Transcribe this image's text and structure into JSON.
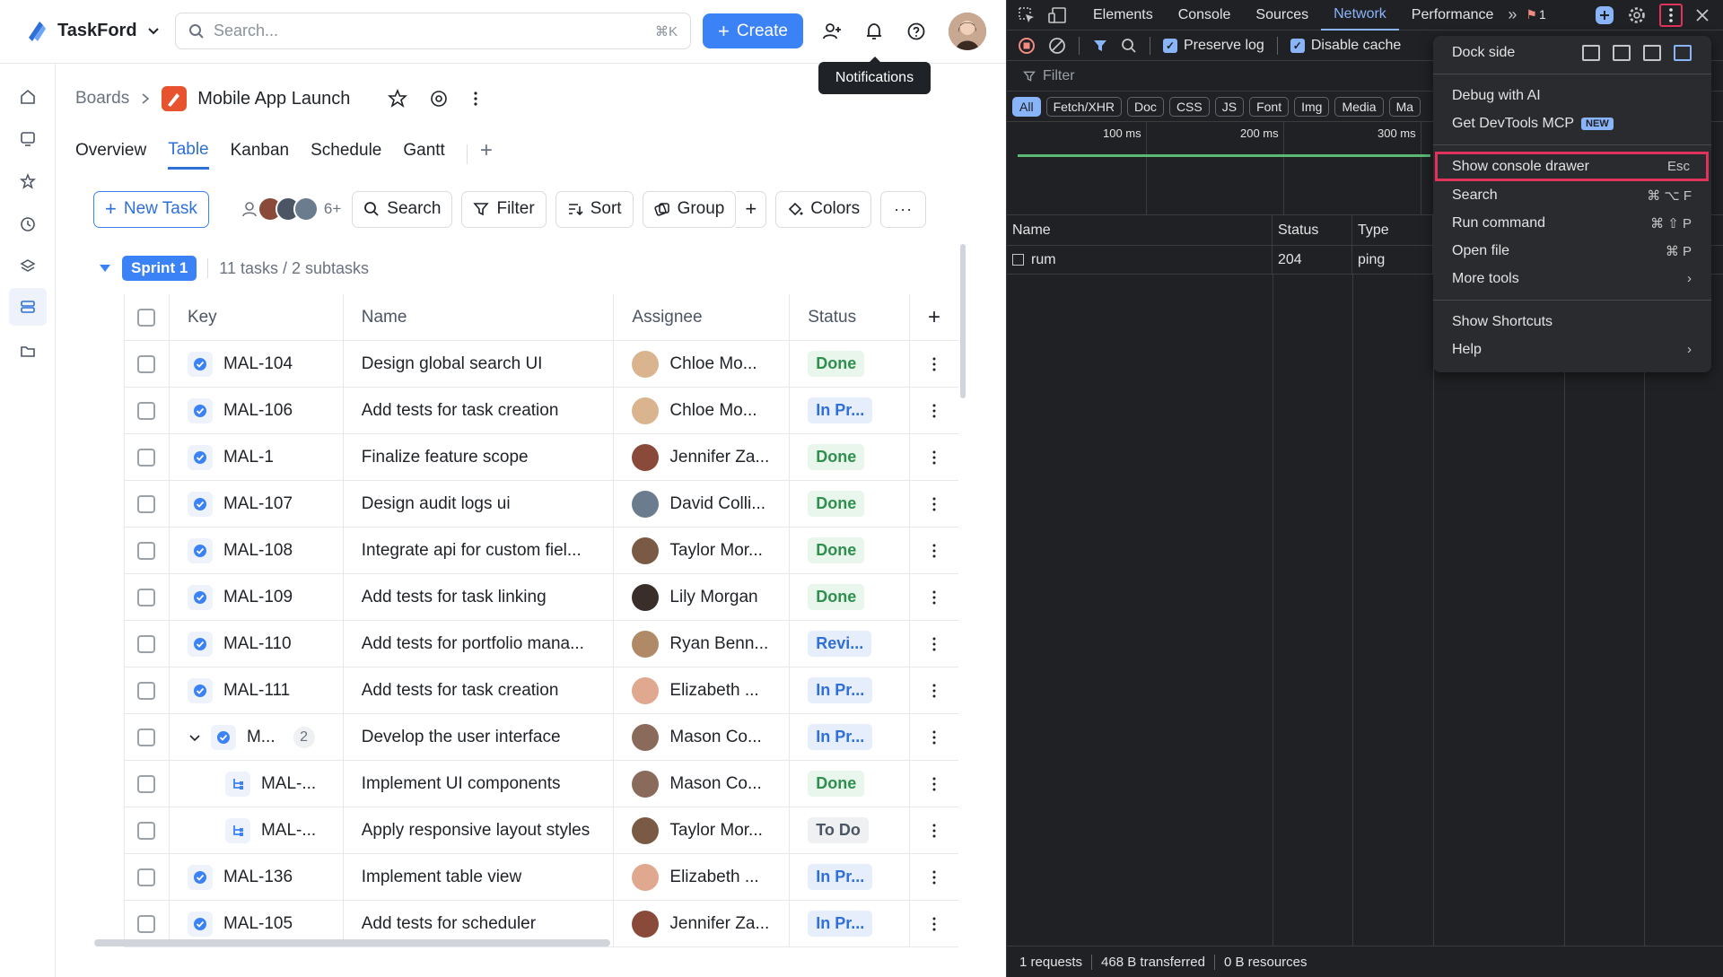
{
  "app": {
    "name": "TaskFord",
    "search": {
      "placeholder": "Search...",
      "shortcut": "⌘K"
    },
    "create_label": "Create",
    "tooltip": "Notifications",
    "breadcrumb": {
      "root": "Boards",
      "project": "Mobile App Launch"
    },
    "tabs": [
      "Overview",
      "Table",
      "Kanban",
      "Schedule",
      "Gantt"
    ],
    "active_tab": "Table",
    "toolbar": {
      "new_task": "New Task",
      "avatar_more": "6+",
      "search": "Search",
      "filter": "Filter",
      "sort": "Sort",
      "group": "Group",
      "colors": "Colors"
    },
    "sprint": {
      "name": "Sprint 1",
      "info": "11 tasks / 2 subtasks"
    },
    "columns": {
      "key": "Key",
      "name": "Name",
      "assignee": "Assignee",
      "status": "Status"
    },
    "rows": [
      {
        "key": "MAL-104",
        "name": "Design global search UI",
        "assignee": "Chloe Mo...",
        "status": "Done",
        "kind": "done",
        "type": "task",
        "avatar_color": "#d9b48f"
      },
      {
        "key": "MAL-106",
        "name": "Add tests for task creation",
        "assignee": "Chloe Mo...",
        "status": "In Pr...",
        "kind": "prog",
        "type": "task",
        "avatar_color": "#d9b48f"
      },
      {
        "key": "MAL-1",
        "name": "Finalize feature scope",
        "assignee": "Jennifer Za...",
        "status": "Done",
        "kind": "done",
        "type": "task",
        "avatar_color": "#8a4a3a"
      },
      {
        "key": "MAL-107",
        "name": "Design audit logs ui",
        "assignee": "David Colli...",
        "status": "Done",
        "kind": "done",
        "type": "task",
        "avatar_color": "#6b7c8f"
      },
      {
        "key": "MAL-108",
        "name": "Integrate api for custom fiel...",
        "assignee": "Taylor Mor...",
        "status": "Done",
        "kind": "done",
        "type": "task",
        "avatar_color": "#7a5a45"
      },
      {
        "key": "MAL-109",
        "name": "Add tests for task linking",
        "assignee": "Lily Morgan",
        "status": "Done",
        "kind": "done",
        "type": "task",
        "avatar_color": "#3a2e2a"
      },
      {
        "key": "MAL-110",
        "name": "Add tests for portfolio mana...",
        "assignee": "Ryan Benn...",
        "status": "Revi...",
        "kind": "prog",
        "type": "task",
        "avatar_color": "#b08a66"
      },
      {
        "key": "MAL-111",
        "name": "Add tests for task creation",
        "assignee": "Elizabeth ...",
        "status": "In Pr...",
        "kind": "prog",
        "type": "task",
        "avatar_color": "#e0a88f"
      },
      {
        "key": "M...",
        "name": "Develop the user interface",
        "assignee": "Mason Co...",
        "status": "In Pr...",
        "kind": "prog",
        "type": "parent",
        "count": "2",
        "avatar_color": "#8a6a5a"
      },
      {
        "key": "MAL-...",
        "name": "Implement UI components",
        "assignee": "Mason Co...",
        "status": "Done",
        "kind": "done",
        "type": "sub",
        "avatar_color": "#8a6a5a"
      },
      {
        "key": "MAL-...",
        "name": "Apply responsive layout styles",
        "assignee": "Taylor Mor...",
        "status": "To Do",
        "kind": "todo",
        "type": "sub",
        "avatar_color": "#7a5a45"
      },
      {
        "key": "MAL-136",
        "name": "Implement table view",
        "assignee": "Elizabeth ...",
        "status": "In Pr...",
        "kind": "prog",
        "type": "task",
        "avatar_color": "#e0a88f"
      },
      {
        "key": "MAL-105",
        "name": "Add tests for scheduler",
        "assignee": "Jennifer Za...",
        "status": "In Pr...",
        "kind": "prog",
        "type": "task",
        "avatar_color": "#8a4a3a"
      }
    ]
  },
  "devtools": {
    "tabs": [
      "Elements",
      "Console",
      "Sources",
      "Network",
      "Performance"
    ],
    "active_tab": "Network",
    "issues_count": "1",
    "preserve_log": "Preserve log",
    "disable_cache": "Disable cache",
    "filter_placeholder": "Filter",
    "type_filters": [
      "All",
      "Fetch/XHR",
      "Doc",
      "CSS",
      "JS",
      "Font",
      "Img",
      "Media",
      "Ma"
    ],
    "timeline_labels": [
      "100 ms",
      "200 ms",
      "300 ms"
    ],
    "columns": {
      "name": "Name",
      "status": "Status",
      "type": "Type"
    },
    "request": {
      "name": "rum",
      "status": "204",
      "type": "ping"
    },
    "status_bar": {
      "requests": "1 requests",
      "transferred": "468 B transferred",
      "resources": "0 B resources"
    },
    "menu": {
      "dock_side": "Dock side",
      "debug_ai": "Debug with AI",
      "mcp": "Get DevTools MCP",
      "mcp_badge": "NEW",
      "console_drawer": "Show console drawer",
      "console_drawer_sc": "Esc",
      "search": "Search",
      "search_sc": "⌘ ⌥ F",
      "run_command": "Run command",
      "run_command_sc": "⌘ ⇧ P",
      "open_file": "Open file",
      "open_file_sc": "⌘ P",
      "more_tools": "More tools",
      "shortcuts": "Show Shortcuts",
      "help": "Help"
    }
  },
  "colors": {
    "accent": "#3b82f6",
    "done": "#2f8f4e",
    "progress": "#2f6fd8",
    "highlight": "#e0325a"
  }
}
